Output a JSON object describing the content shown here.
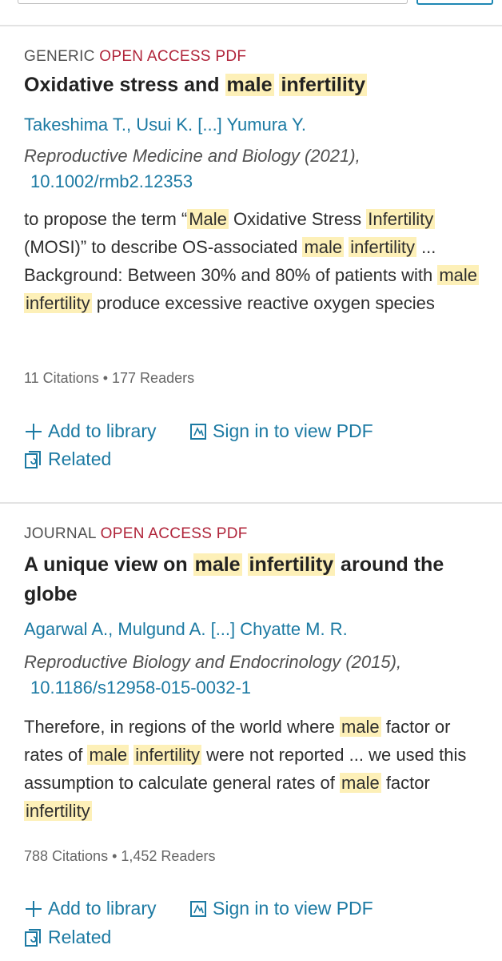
{
  "articles": [
    {
      "type": "GENERIC",
      "oa": "OPEN ACCESS",
      "pdf": "PDF",
      "title": [
        {
          "t": "Oxidative stress and ",
          "h": false
        },
        {
          "t": "male",
          "h": true
        },
        {
          "t": " ",
          "h": false
        },
        {
          "t": "infertility",
          "h": true
        }
      ],
      "authors": "Takeshima T., Usui K. [...] Yumura Y.",
      "journal": "Reproductive Medicine and Biology (2021),",
      "doi": "10.1002/rmb2.12353",
      "snippet": [
        {
          "t": "to propose the term “",
          "h": false
        },
        {
          "t": "Male",
          "h": true
        },
        {
          "t": " Oxidative Stress ",
          "h": false
        },
        {
          "t": "Infertility",
          "h": true
        },
        {
          "t": " (MOSI)” to describe OS-associated ",
          "h": false
        },
        {
          "t": "male",
          "h": true
        },
        {
          "t": " ",
          "h": false
        },
        {
          "t": "infertility",
          "h": true
        },
        {
          "t": " ... Background: Between 30% and 80% of patients with ",
          "h": false
        },
        {
          "t": "male",
          "h": true
        },
        {
          "t": " ",
          "h": false
        },
        {
          "t": "infertility",
          "h": true
        },
        {
          "t": " produce excessive reactive oxygen species",
          "h": false
        }
      ],
      "stats": "11 Citations • 177 Readers",
      "actions": {
        "add": "Add to library",
        "signin": "Sign in to view PDF",
        "related": "Related"
      }
    },
    {
      "type": "JOURNAL",
      "oa": "OPEN ACCESS",
      "pdf": "PDF",
      "title": [
        {
          "t": "A unique view on ",
          "h": false
        },
        {
          "t": "male",
          "h": true
        },
        {
          "t": " ",
          "h": false
        },
        {
          "t": "infertility",
          "h": true
        },
        {
          "t": " around the globe",
          "h": false
        }
      ],
      "authors": "Agarwal A., Mulgund A. [...] Chyatte M. R.",
      "journal": "Reproductive Biology and Endocrinology (2015),",
      "doi": "10.1186/s12958-015-0032-1",
      "snippet": [
        {
          "t": "Therefore, in regions of the world where ",
          "h": false
        },
        {
          "t": "male",
          "h": true
        },
        {
          "t": " factor or rates of ",
          "h": false
        },
        {
          "t": "male",
          "h": true
        },
        {
          "t": " ",
          "h": false
        },
        {
          "t": "infertility",
          "h": true
        },
        {
          "t": " were not reported ... we used this assumption to calculate general rates of ",
          "h": false
        },
        {
          "t": "male",
          "h": true
        },
        {
          "t": " factor ",
          "h": false
        },
        {
          "t": "infertility",
          "h": true
        }
      ],
      "stats": "788 Citations • 1,452 Readers",
      "actions": {
        "add": "Add to library",
        "signin": "Sign in to view PDF",
        "related": "Related"
      }
    }
  ]
}
